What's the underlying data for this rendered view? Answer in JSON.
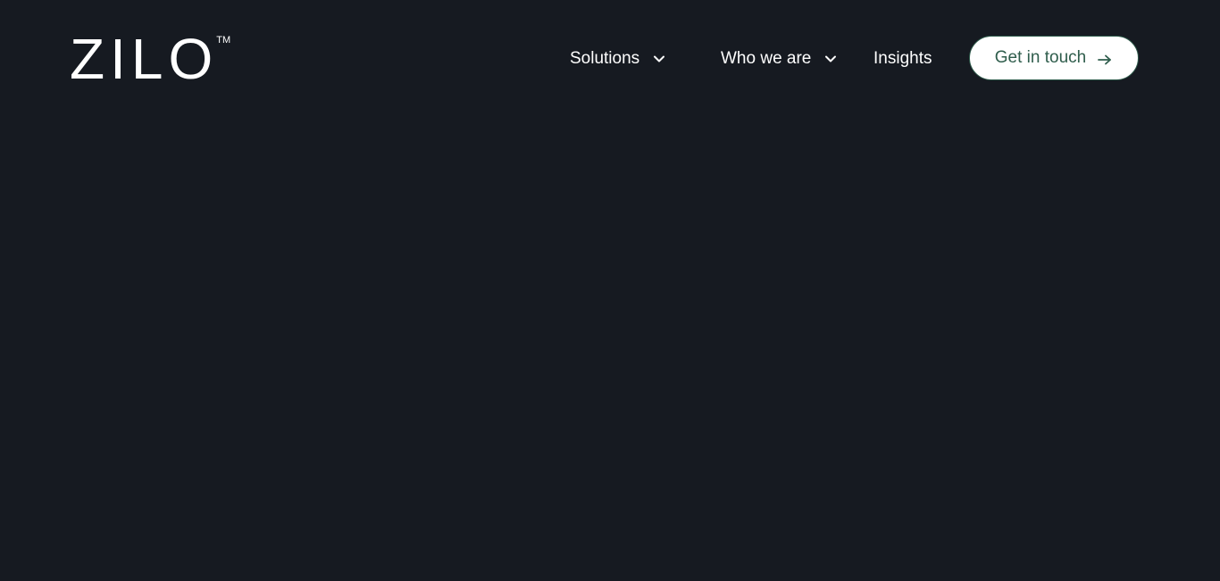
{
  "brand": {
    "logo_text": "ZILO",
    "trademark": "TM"
  },
  "nav": {
    "items": [
      {
        "label": "Solutions",
        "has_dropdown": true,
        "icon": "chevron-down-icon"
      },
      {
        "label": "Who we are",
        "has_dropdown": true,
        "icon": "chevron-down-icon"
      },
      {
        "label": "Insights",
        "has_dropdown": false
      }
    ]
  },
  "cta": {
    "label": "Get in touch",
    "icon": "arrow-right-icon"
  },
  "colors": {
    "background": "#161a21",
    "text": "#ffffff",
    "cta_background": "#ffffff",
    "cta_text": "#2f5d4c",
    "cta_border": "#2d5a4a"
  }
}
